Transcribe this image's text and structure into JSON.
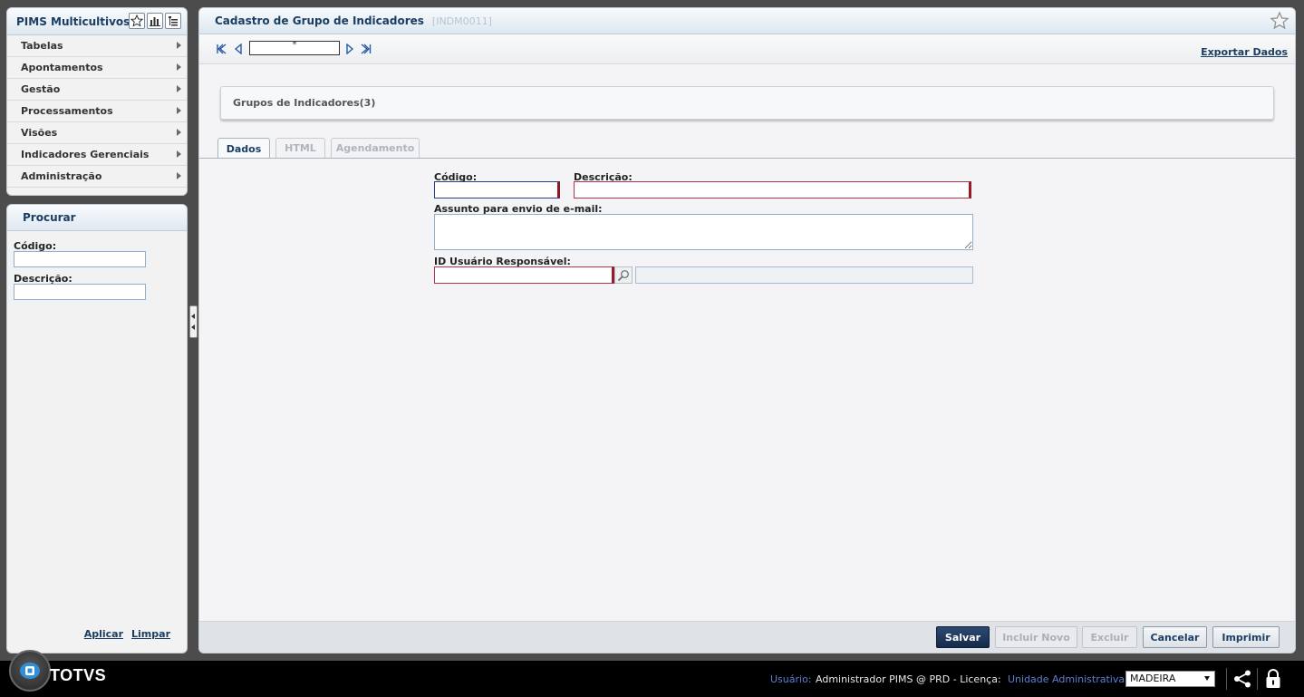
{
  "app": {
    "title": "PIMS Multicultivos"
  },
  "menu": {
    "items": [
      {
        "label": "Tabelas"
      },
      {
        "label": "Apontamentos"
      },
      {
        "label": "Gestão"
      },
      {
        "label": "Processamentos"
      },
      {
        "label": "Visões"
      },
      {
        "label": "Indicadores Gerenciais"
      },
      {
        "label": "Administração"
      }
    ]
  },
  "search": {
    "title": "Procurar",
    "codigo_label": "Código:",
    "codigo_value": "",
    "descricao_label": "Descrição:",
    "descricao_value": "",
    "apply": "Aplicar",
    "clear": "Limpar"
  },
  "page": {
    "title": "Cadastro de Grupo de Indicadores",
    "code": "[INDM0011]",
    "export": "Exportar Dados",
    "record_indicator": "*",
    "group_title": "Grupos de Indicadores(3)"
  },
  "tabs": [
    {
      "label": "Dados",
      "active": true
    },
    {
      "label": "HTML",
      "active": false
    },
    {
      "label": "Agendamento",
      "active": false
    }
  ],
  "form": {
    "codigo_label": "Código:",
    "codigo_value": "",
    "descricao_label": "Descrição:",
    "descricao_value": "",
    "assunto_label": "Assunto para envio de e-mail:",
    "assunto_value": "",
    "usuario_label": "ID Usuário Responsável:",
    "usuario_value": "",
    "usuario_name_value": ""
  },
  "buttons": {
    "save": "Salvar",
    "new": "Incluir Novo",
    "delete": "Excluir",
    "cancel": "Cancelar",
    "print": "Imprimir"
  },
  "footer": {
    "brand": "TOTVS",
    "user_label": "Usuário:",
    "user_value": "Administrador PIMS @ PRD - Licença:",
    "unit_label": "Unidade Administrativa:",
    "unit_value": "MADEIRA"
  },
  "colors": {
    "header_text": "#1a3e63",
    "primary_button": "#1c3459",
    "required_border": "#9a1a2a",
    "footer_label": "#5b7fd6"
  }
}
